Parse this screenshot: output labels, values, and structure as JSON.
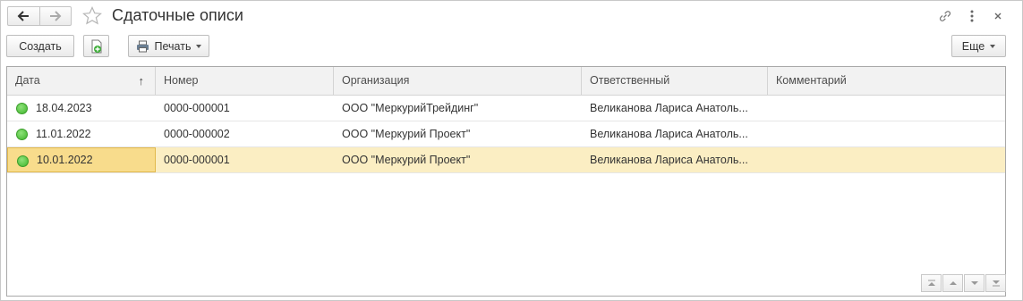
{
  "window": {
    "title": "Сдаточные описи"
  },
  "toolbar": {
    "create_label": "Создать",
    "print_label": "Печать",
    "more_label": "Еще"
  },
  "table": {
    "columns": [
      "Дата",
      "Номер",
      "Организация",
      "Ответственный",
      "Комментарий"
    ],
    "sort_indicator": "↑",
    "rows": [
      {
        "date": "18.04.2023",
        "number": "0000-000001",
        "org": "ООО \"МеркурийТрейдинг\"",
        "responsible": "Великанова Лариса Анатоль...",
        "comment": "",
        "status": "posted"
      },
      {
        "date": "11.01.2022",
        "number": "0000-000002",
        "org": "ООО \"Меркурий Проект\"",
        "responsible": "Великанова Лариса Анатоль...",
        "comment": "",
        "status": "posted"
      },
      {
        "date": "10.01.2022",
        "number": "0000-000001",
        "org": "ООО \"Меркурий Проект\"",
        "responsible": "Великанова Лариса Анатоль...",
        "comment": "",
        "status": "posted",
        "selected": true
      }
    ]
  },
  "icons": {
    "back": "arrow-left-icon",
    "forward": "arrow-right-icon",
    "favorite": "star-icon",
    "link": "link-icon",
    "more": "kebab-menu-icon",
    "close": "close-icon",
    "add_copy": "document-add-icon",
    "print": "printer-icon",
    "status": "status-dot-icon",
    "first": "scroll-first-icon",
    "prev": "scroll-up-icon",
    "next": "scroll-down-icon",
    "last": "scroll-last-icon"
  },
  "colors": {
    "selected_row": "#fbeec3",
    "selected_cell": "#f8dc8c",
    "status_green": "#3fb52c"
  }
}
